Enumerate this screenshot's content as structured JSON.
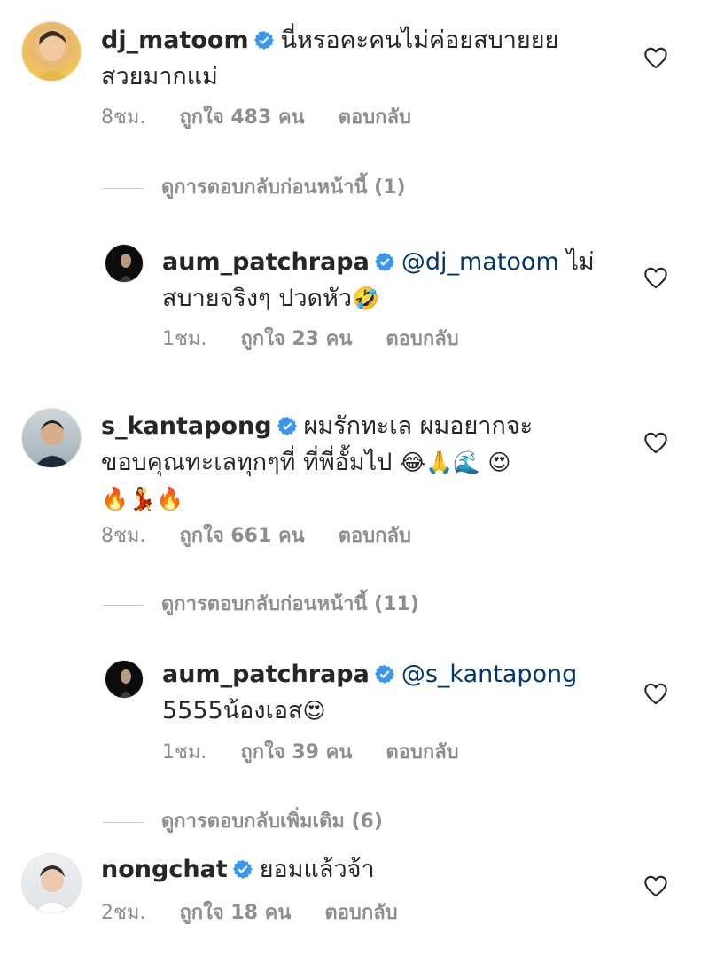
{
  "comments": [
    {
      "username": "dj_matoom",
      "text": "นี่หรอคะคนไม่ค่อยสบายยย สวยมากแม่",
      "time": "8ชม.",
      "likes": "ถูกใจ 483 คน",
      "reply": "ตอบกลับ",
      "toggle": "ดูการตอบกลับก่อนหน้านี้ (1)",
      "replies": [
        {
          "username": "aum_patchrapa",
          "mention": "@dj_matoom",
          "text": " ไม่สบายจริงๆ ปวดหัว",
          "emoji": "🤣",
          "time": "1ชม.",
          "likes": "ถูกใจ 23 คน",
          "reply": "ตอบกลับ"
        }
      ]
    },
    {
      "username": "s_kantapong",
      "text": "ผมรักทะเล ผมอยากจะขอบคุณทะเลทุกๆที่ ที่พี่อั้มไป",
      "emoji_line1": "😂🙏🌊 😍",
      "emoji_line2": "🔥💃🔥",
      "time": "8ชม.",
      "likes": "ถูกใจ 661 คน",
      "reply": "ตอบกลับ",
      "toggle": "ดูการตอบกลับก่อนหน้านี้ (11)",
      "replies": [
        {
          "username": "aum_patchrapa",
          "mention": "@s_kantapong",
          "text": "5555น้องเอส",
          "emoji": "😍",
          "time": "1ชม.",
          "likes": "ถูกใจ 39 คน",
          "reply": "ตอบกลับ"
        }
      ],
      "toggle_more": "ดูการตอบกลับเพิ่มเติม (6)"
    },
    {
      "username": "nongchat",
      "text": "ยอมแล้วจ้า",
      "time": "2ชม.",
      "likes": "ถูกใจ 18 คน",
      "reply": "ตอบกลับ"
    }
  ],
  "colors": {
    "verified": "#3897f0",
    "mention": "#00376b",
    "meta": "#8e8e8e"
  }
}
